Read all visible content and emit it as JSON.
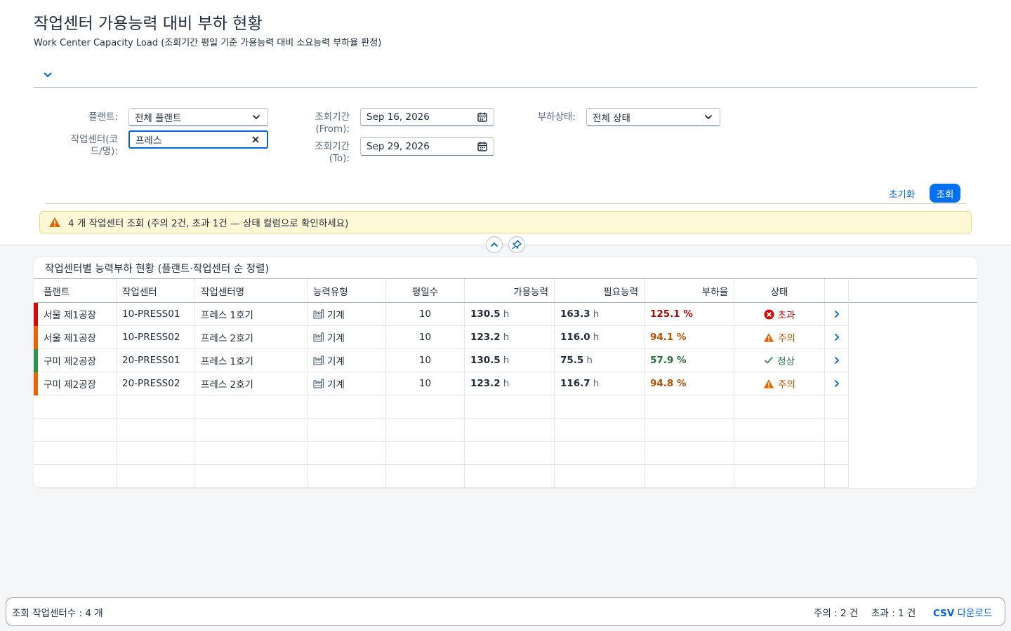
{
  "page": {
    "title": "작업센터 가용능력 대비 부하 현황",
    "subtitle": "Work Center Capacity Load (조회기간 평일 기준 가용능력 대비 소요능력 부하율 판정)"
  },
  "filters": {
    "plant_label": "플랜트:",
    "plant_value": "전체 플랜트",
    "workcenter_label_1": "작업센터(코",
    "workcenter_label_2": "드/명):",
    "workcenter_value": "프레스",
    "from_label_1": "조회기간",
    "from_label_2": "(From):",
    "from_value": "Sep 16, 2026",
    "to_label_1": "조회기간",
    "to_label_2": "(To):",
    "to_value": "Sep 29, 2026",
    "status_label": "부하상태:",
    "status_value": "전체 상태",
    "reset_label": "초기화",
    "search_label": "조회"
  },
  "message": {
    "text": "4 개 작업센터 조회 (주의 2건, 초과 1건 — 상태 컬럼으로 확인하세요)"
  },
  "table": {
    "title": "작업센터별 능력부하 현황 (플랜트·작업센터 순 정렬)",
    "columns": [
      "플랜트",
      "작업센터",
      "작업센터명",
      "능력유형",
      "평일수",
      "가용능력",
      "필요능력",
      "부하율",
      "상태"
    ],
    "rows": [
      {
        "plant": "서울 제1공장",
        "wc": "10-PRESS01",
        "name": "프레스 1호기",
        "type": "기계",
        "days": "10",
        "avail": "130.5",
        "req": "163.3",
        "unit": "h",
        "load": "125.1 %",
        "status": "초과",
        "level": "over"
      },
      {
        "plant": "서울 제1공장",
        "wc": "10-PRESS02",
        "name": "프레스 2호기",
        "type": "기계",
        "days": "10",
        "avail": "123.2",
        "req": "116.0",
        "unit": "h",
        "load": "94.1 %",
        "status": "주의",
        "level": "warn"
      },
      {
        "plant": "구미 제2공장",
        "wc": "20-PRESS01",
        "name": "프레스 1호기",
        "type": "기계",
        "days": "10",
        "avail": "130.5",
        "req": "75.5",
        "unit": "h",
        "load": "57.9 %",
        "status": "정상",
        "level": "ok"
      },
      {
        "plant": "구미 제2공장",
        "wc": "20-PRESS02",
        "name": "프레스 2호기",
        "type": "기계",
        "days": "10",
        "avail": "123.2",
        "req": "116.7",
        "unit": "h",
        "load": "94.8 %",
        "status": "주의",
        "level": "warn"
      }
    ]
  },
  "footer": {
    "count": "조회 작업센터수 : 4 개",
    "warn_count": "주의 : 2 건",
    "over_count": "초과 : 1 건",
    "csv_bold": "CSV",
    "csv_rest": " 다운로드"
  },
  "colors": {
    "over": "#d20a0a",
    "warn": "#e76500",
    "ok": "#30914c",
    "over_text": "#aa0808",
    "warn_text": "#b44f00",
    "ok_text": "#256f3a",
    "accent": "#0070f2"
  },
  "icons": {
    "expand": "chevron-down-icon",
    "dropdown": "chevron-down-icon",
    "clear": "close-icon",
    "calendar": "calendar-icon",
    "warning": "warning-icon",
    "collapse": "chevron-up-icon",
    "pin": "pin-icon",
    "machine": "factory-icon",
    "error": "error-circle-icon",
    "ok": "checkmark-icon",
    "nav": "chevron-right-icon"
  }
}
